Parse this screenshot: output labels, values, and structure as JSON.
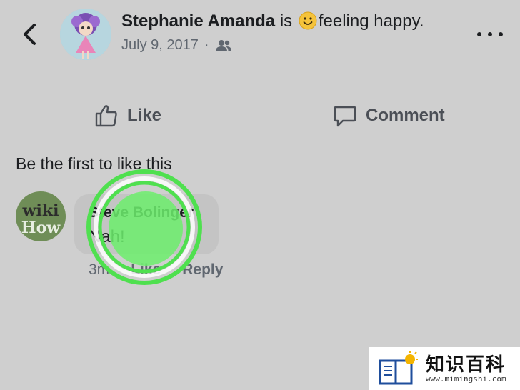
{
  "post": {
    "author": "Stephanie Amanda",
    "verb": "is",
    "feeling": "feeling happy.",
    "date": "July 9, 2017",
    "separator": "·",
    "audience_icon": "friends-icon"
  },
  "actions": {
    "like_label": "Like",
    "comment_label": "Comment"
  },
  "likes_summary": "Be the first to like this",
  "comment": {
    "avatar_line1": "wiki",
    "avatar_line2": "How",
    "author": "Steve Bolinger",
    "text": "Nah!",
    "timestamp": "3m",
    "like_label": "Like",
    "reply_label": "Reply"
  },
  "watermark": {
    "chinese": "知识百科",
    "url": "www.mimingshi.com"
  },
  "colors": {
    "background": "#cfcfcf",
    "touch_indicator": "#5ee85e",
    "text_secondary": "#606770"
  }
}
